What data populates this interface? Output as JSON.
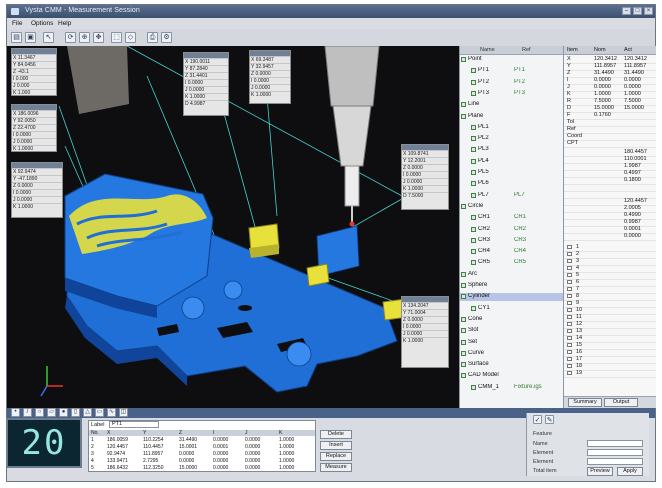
{
  "window": {
    "title": "Vysta CMM - Measurement Session"
  },
  "menu": [
    "File",
    "Options",
    "Help"
  ],
  "toolbar_icons": [
    "open-icon",
    "save-icon",
    "cursor-icon",
    "rotate-icon",
    "zoom-icon",
    "pan-icon",
    "fit-icon",
    "measure-icon",
    "print-icon",
    "settings-icon"
  ],
  "tree": {
    "header": [
      "Name",
      "Ref"
    ],
    "nodes": [
      {
        "label": "Point",
        "sub": ""
      },
      {
        "label": "PT1",
        "sub": "PT1"
      },
      {
        "label": "PT2",
        "sub": "PT2"
      },
      {
        "label": "PT3",
        "sub": "PT3"
      },
      {
        "label": "Line",
        "sub": ""
      },
      {
        "label": "Plane",
        "sub": ""
      },
      {
        "label": "PL1",
        "sub": ""
      },
      {
        "label": "PL2",
        "sub": ""
      },
      {
        "label": "PL3",
        "sub": ""
      },
      {
        "label": "PL4",
        "sub": ""
      },
      {
        "label": "PL5",
        "sub": ""
      },
      {
        "label": "PL6",
        "sub": ""
      },
      {
        "label": "PL7",
        "sub": "PL7"
      },
      {
        "label": "Circle",
        "sub": ""
      },
      {
        "label": "CR1",
        "sub": "CR1"
      },
      {
        "label": "CR2",
        "sub": "CR2"
      },
      {
        "label": "CR3",
        "sub": "CR3"
      },
      {
        "label": "CR4",
        "sub": "CR4"
      },
      {
        "label": "CR5",
        "sub": "CR5"
      },
      {
        "label": "Arc",
        "sub": ""
      },
      {
        "label": "Sphere",
        "sub": ""
      },
      {
        "label": "Cylinder",
        "sub": ""
      },
      {
        "label": "CY1",
        "sub": ""
      },
      {
        "label": "Cone",
        "sub": ""
      },
      {
        "label": "Slot",
        "sub": ""
      },
      {
        "label": "Set",
        "sub": ""
      },
      {
        "label": "Curve",
        "sub": ""
      },
      {
        "label": "Surface",
        "sub": ""
      },
      {
        "label": "CAD Model",
        "sub": ""
      },
      {
        "label": "CMM_1",
        "sub": "Fixture.igs"
      }
    ]
  },
  "props": {
    "header": [
      "Item",
      "Nom",
      "Act"
    ],
    "rows": [
      {
        "a": "X",
        "b": "120.3412",
        "c": "120.3412"
      },
      {
        "a": "Y",
        "b": "111.8957",
        "c": "111.8957"
      },
      {
        "a": "Z",
        "b": "31.4490",
        "c": "31.4490"
      },
      {
        "a": "I",
        "b": "0.0000",
        "c": "0.0000"
      },
      {
        "a": "J",
        "b": "0.0000",
        "c": "0.0000"
      },
      {
        "a": "K",
        "b": "1.0000",
        "c": "1.0000"
      },
      {
        "a": "R",
        "b": "7.5000",
        "c": "7.5000"
      },
      {
        "a": "D",
        "b": "15.0000",
        "c": "15.0000"
      },
      {
        "a": "F",
        "b": "0.1760",
        "c": ""
      },
      {
        "a": "Tol",
        "b": "",
        "c": ""
      },
      {
        "a": "Ref",
        "b": "",
        "c": ""
      },
      {
        "a": "Coord",
        "b": "",
        "c": ""
      },
      {
        "a": "CPT",
        "b": "",
        "c": ""
      }
    ],
    "list_values": [
      "180.4457",
      "110.0001",
      "1.9987",
      "0.4997",
      "0.1800",
      "",
      "",
      "120.4457",
      "2.0005",
      "0.4990",
      "0.9987",
      "0.0001",
      "0.0000"
    ],
    "checks": [
      "1",
      "2",
      "3",
      "4",
      "5",
      "6",
      "7",
      "8",
      "9",
      "10",
      "11",
      "12",
      "13",
      "14",
      "15",
      "16",
      "17",
      "18",
      "19"
    ],
    "tabs": [
      "Summary",
      "Output"
    ]
  },
  "overlays": [
    {
      "rows": [
        "X  11.3467",
        "Y  84.0456",
        "Z  -43.1",
        "I   0.000",
        "J   0.000",
        "K   1.000",
        "R   7.498"
      ]
    },
    {
      "rows": [
        "X  186.0096",
        "Y  92.0050",
        "Z  22.4700",
        "I   0.0000",
        "J   0.0000",
        "K   1.0000"
      ]
    },
    {
      "rows": [
        "X  92.9474",
        "Y  -47.1890",
        "Z   0.0000",
        "I   0.0000",
        "J   0.0000",
        "K   1.0000"
      ]
    },
    {
      "rows": [
        "X  190.0011",
        "Y  87.2840",
        "Z  31.4401",
        "I   0.0000",
        "J   0.0000",
        "K   1.0000",
        "D   4.9987"
      ]
    },
    {
      "rows": [
        "X  69.3487",
        "Y  32.9457",
        "Z   0.0000",
        "I   0.0000",
        "J   0.0000",
        "K   1.0000",
        "R  15.0000"
      ]
    },
    {
      "rows": [
        "X  109.8741",
        "Y  12.2001",
        "Z   0.0000",
        "I   0.0000",
        "J   0.0000",
        "K   1.0000",
        "D   7.5000"
      ]
    },
    {
      "rows": [
        "X  134.2047",
        "Y  71.0004",
        "Z   0.0000",
        "I   0.0000",
        "J   0.0000",
        "K   1.0000"
      ]
    }
  ],
  "counter": "20",
  "table": {
    "filter_label": "Label",
    "filter_value": "PT1",
    "columns": [
      "No.",
      "X",
      "Y",
      "Z",
      "I",
      "J",
      "K"
    ],
    "rows": [
      [
        "1",
        "186.0059",
        "110.2254",
        "31.4490",
        "0.0000",
        "0.0000",
        "1.0000"
      ],
      [
        "2",
        "120.4457",
        "110.4457",
        "15.0001",
        "0.0001",
        "0.0000",
        "1.0000"
      ],
      [
        "3",
        "92.9474",
        "111.8957",
        "0.0000",
        "0.0000",
        "0.0000",
        "1.0000"
      ],
      [
        "4",
        "133.9471",
        "2.7295",
        "0.0000",
        "0.0000",
        "0.0000",
        "1.0000"
      ],
      [
        "5",
        "186.6432",
        "112.3250",
        "15.0000",
        "0.0000",
        "0.0000",
        "1.0000"
      ]
    ]
  },
  "buttons": {
    "delete": "Delete",
    "insert": "Insert",
    "replace": "Replace",
    "measure": "Measure"
  },
  "form": {
    "labels": [
      "Feature",
      "Name",
      "Element",
      "Element"
    ],
    "fields": [
      "",
      "",
      "",
      ""
    ],
    "label_bottom": "Total item",
    "preview_button": "Preview",
    "apply_button": "Apply"
  },
  "colors": {
    "part_blue": "#1f6fd6",
    "accent_yellow": "#e8e13b",
    "guide_cyan": "#45d1cf",
    "viewport_bg": "#0e0e10"
  }
}
